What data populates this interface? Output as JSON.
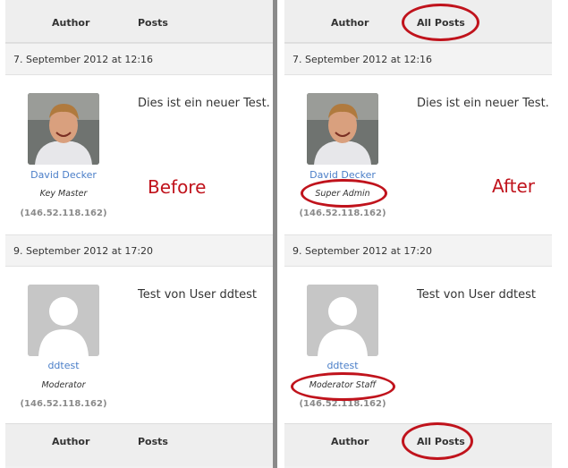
{
  "before": {
    "header": {
      "author_label": "Author",
      "posts_label": "Posts"
    },
    "footer": {
      "author_label": "Author",
      "posts_label": "Posts"
    },
    "posts": [
      {
        "date": "7. September 2012 at 12:16",
        "author_name": "David Decker",
        "author_role": "Key Master",
        "author_ip": "(146.52.118.162)",
        "content": "Dies ist ein neuer Test."
      },
      {
        "date": "9. September 2012 at 17:20",
        "author_name": "ddtest",
        "author_role": "Moderator",
        "author_ip": "(146.52.118.162)",
        "content": "Test von User ddtest"
      }
    ],
    "caption": "Before"
  },
  "after": {
    "header": {
      "author_label": "Author",
      "posts_label": "All Posts"
    },
    "footer": {
      "author_label": "Author",
      "posts_label": "All Posts"
    },
    "posts": [
      {
        "date": "7. September 2012 at 12:16",
        "author_name": "David Decker",
        "author_role": "Super Admin",
        "author_ip": "(146.52.118.162)",
        "content": "Dies ist ein neuer Test."
      },
      {
        "date": "9. September 2012 at 17:20",
        "author_name": "ddtest",
        "author_role": "Moderator Staff",
        "author_ip": "(146.52.118.162)",
        "content": "Test von User ddtest"
      }
    ],
    "caption": "After"
  },
  "colors": {
    "annotation": "#c0131c",
    "author_link": "#4a7ec8",
    "ip_text": "#8a8a8a"
  }
}
